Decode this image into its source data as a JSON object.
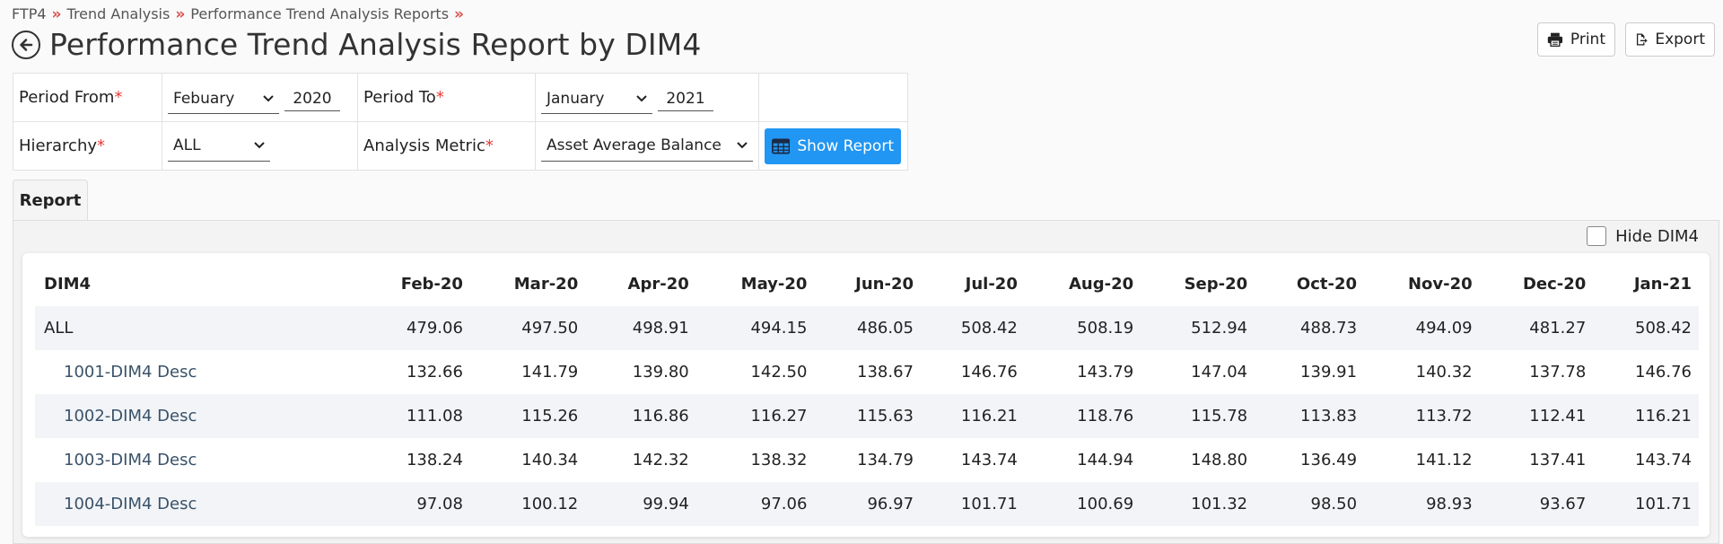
{
  "breadcrumb": [
    "FTP4",
    "Trend Analysis",
    "Performance Trend Analysis Reports"
  ],
  "breadcrumb_sep": "»",
  "title": "Performance Trend Analysis Report by DIM4",
  "buttons": {
    "print": "Print",
    "export": "Export",
    "show_report": "Show Report"
  },
  "filters": {
    "period_from_label": "Period From",
    "period_from_month": "Febuary",
    "period_from_year": "2020",
    "period_to_label": "Period To",
    "period_to_month": "January",
    "period_to_year": "2021",
    "hierarchy_label": "Hierarchy",
    "hierarchy_value": "ALL",
    "metric_label": "Analysis Metric",
    "metric_value": "Asset Average Balance",
    "required_mark": "*"
  },
  "tab_label": "Report",
  "hide_dim4_label": "Hide DIM4",
  "hide_dim4_checked": false,
  "table": {
    "columns": [
      "DIM4",
      "Feb-20",
      "Mar-20",
      "Apr-20",
      "May-20",
      "Jun-20",
      "Jul-20",
      "Aug-20",
      "Sep-20",
      "Oct-20",
      "Nov-20",
      "Dec-20",
      "Jan-21"
    ],
    "rows": [
      {
        "name": "ALL",
        "child": false,
        "values": [
          "479.06",
          "497.50",
          "498.91",
          "494.15",
          "486.05",
          "508.42",
          "508.19",
          "512.94",
          "488.73",
          "494.09",
          "481.27",
          "508.42"
        ]
      },
      {
        "name": "1001-DIM4 Desc",
        "child": true,
        "values": [
          "132.66",
          "141.79",
          "139.80",
          "142.50",
          "138.67",
          "146.76",
          "143.79",
          "147.04",
          "139.91",
          "140.32",
          "137.78",
          "146.76"
        ]
      },
      {
        "name": "1002-DIM4 Desc",
        "child": true,
        "values": [
          "111.08",
          "115.26",
          "116.86",
          "116.27",
          "115.63",
          "116.21",
          "118.76",
          "115.78",
          "113.83",
          "113.72",
          "112.41",
          "116.21"
        ]
      },
      {
        "name": "1003-DIM4 Desc",
        "child": true,
        "values": [
          "138.24",
          "140.34",
          "142.32",
          "138.32",
          "134.79",
          "143.74",
          "144.94",
          "148.80",
          "136.49",
          "141.12",
          "137.41",
          "143.74"
        ]
      },
      {
        "name": "1004-DIM4 Desc",
        "child": true,
        "values": [
          "97.08",
          "100.12",
          "99.94",
          "97.06",
          "96.97",
          "101.71",
          "100.69",
          "101.32",
          "98.50",
          "98.93",
          "93.67",
          "101.71"
        ]
      }
    ]
  },
  "colors": {
    "accent": "#2196f3",
    "required": "#e53935",
    "breadcrumb_sep": "#d9534f"
  }
}
